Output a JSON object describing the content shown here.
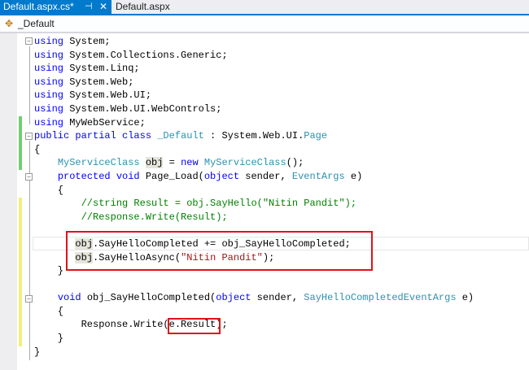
{
  "tabs": {
    "active": "Default.aspx.cs*",
    "pin": "⊣",
    "close": "✕",
    "inactive": "Default.aspx"
  },
  "navbar": {
    "class_label": "_Default"
  },
  "code_lines": [
    [
      [
        "using",
        "kw"
      ],
      [
        " System;",
        "tx"
      ]
    ],
    [
      [
        "using",
        "kw"
      ],
      [
        " System.Collections.Generic;",
        "tx"
      ]
    ],
    [
      [
        "using",
        "kw"
      ],
      [
        " System.Linq;",
        "tx"
      ]
    ],
    [
      [
        "using",
        "kw"
      ],
      [
        " System.Web;",
        "tx"
      ]
    ],
    [
      [
        "using",
        "kw"
      ],
      [
        " System.Web.UI;",
        "tx"
      ]
    ],
    [
      [
        "using",
        "kw"
      ],
      [
        " System.Web.UI.WebControls;",
        "tx"
      ]
    ],
    [
      [
        "using",
        "kw"
      ],
      [
        " MyWebService;",
        "tx"
      ]
    ],
    [
      [
        "public partial class",
        "kw"
      ],
      [
        " ",
        "tx"
      ],
      [
        "_Default",
        "ty"
      ],
      [
        " : System.Web.UI.",
        "tx"
      ],
      [
        "Page",
        "ty"
      ]
    ],
    [
      [
        "{",
        "tx"
      ]
    ],
    [
      [
        "    ",
        "tx"
      ],
      [
        "MyServiceClass",
        "ty"
      ],
      [
        " ",
        "tx"
      ],
      [
        "obj",
        "hl"
      ],
      [
        " = ",
        "tx"
      ],
      [
        "new",
        "kw"
      ],
      [
        " ",
        "tx"
      ],
      [
        "MyServiceClass",
        "ty"
      ],
      [
        "();",
        "tx"
      ]
    ],
    [
      [
        "    ",
        "tx"
      ],
      [
        "protected void",
        "kw"
      ],
      [
        " Page_Load(",
        "tx"
      ],
      [
        "object",
        "kw"
      ],
      [
        " sender, ",
        "tx"
      ],
      [
        "EventArgs",
        "ty"
      ],
      [
        " e)",
        "tx"
      ]
    ],
    [
      [
        "    {",
        "tx"
      ]
    ],
    [
      [
        "        //string Result = obj.SayHello(\"Nitin Pandit\");",
        "cm"
      ]
    ],
    [
      [
        "        //Response.Write(Result);",
        "cm"
      ]
    ],
    [
      [
        "",
        "tx"
      ]
    ],
    [
      [
        "       ",
        "tx"
      ],
      [
        "obj",
        "hl"
      ],
      [
        ".SayHelloCompleted += obj_SayHelloCompleted;",
        "tx"
      ]
    ],
    [
      [
        "       ",
        "tx"
      ],
      [
        "obj",
        "hl"
      ],
      [
        ".SayHelloAsync(",
        "tx"
      ],
      [
        "\"Nitin Pandit\"",
        "st"
      ],
      [
        ");",
        "tx"
      ]
    ],
    [
      [
        "    }",
        "tx"
      ]
    ],
    [
      [
        "",
        "tx"
      ]
    ],
    [
      [
        "    ",
        "tx"
      ],
      [
        "void",
        "kw"
      ],
      [
        " obj_SayHelloCompleted(",
        "tx"
      ],
      [
        "object",
        "kw"
      ],
      [
        " sender, ",
        "tx"
      ],
      [
        "SayHelloCompletedEventArgs",
        "ty"
      ],
      [
        " e)",
        "tx"
      ]
    ],
    [
      [
        "    {",
        "tx"
      ]
    ],
    [
      [
        "        Response.Write(e.Result);",
        "tx"
      ]
    ],
    [
      [
        "    }",
        "tx"
      ]
    ],
    [
      [
        "}",
        "tx"
      ]
    ]
  ]
}
